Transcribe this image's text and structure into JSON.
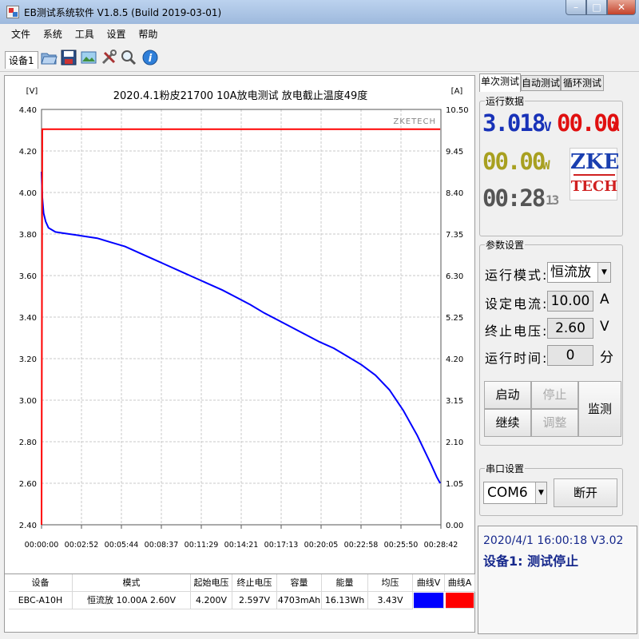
{
  "window": {
    "title": "EB测试系统软件 V1.8.5 (Build 2019-03-01)",
    "min": "–",
    "max": "□",
    "close": "✕"
  },
  "menu": [
    "文件",
    "系统",
    "工具",
    "设置",
    "帮助"
  ],
  "toolbar": {
    "device_tab": "设备1",
    "icons": [
      "open-folder-icon",
      "save-disk-icon",
      "picture-icon",
      "tools-icon",
      "search-icon",
      "info-icon"
    ]
  },
  "chart_data": {
    "type": "line",
    "title": "2020.4.1粉皮21700 10A放电测试 放电截止温度49度",
    "watermark": "ZKETECH",
    "left_unit": "[V]",
    "right_unit": "[A]",
    "y_left_ticks": [
      "4.40",
      "4.20",
      "4.00",
      "3.80",
      "3.60",
      "3.40",
      "3.20",
      "3.00",
      "2.80",
      "2.60",
      "2.40"
    ],
    "y_right_ticks": [
      "10.50",
      "9.45",
      "8.40",
      "7.35",
      "6.30",
      "5.25",
      "4.20",
      "3.15",
      "2.10",
      "1.05",
      "0.00"
    ],
    "x_ticks": [
      "00:00:00",
      "00:02:52",
      "00:05:44",
      "00:08:37",
      "00:11:29",
      "00:14:21",
      "00:17:13",
      "00:20:05",
      "00:22:58",
      "00:25:50",
      "00:28:42"
    ],
    "ylim_left": [
      2.4,
      4.4
    ],
    "ylim_right": [
      0.0,
      10.5
    ],
    "xlim_min": [
      0,
      28.7
    ],
    "grid": true,
    "series": [
      {
        "name": "曲线V",
        "axis": "left",
        "color": "#0000ff",
        "x": [
          0,
          0.05,
          0.15,
          0.3,
          0.5,
          1,
          1.5,
          2,
          2.5,
          3,
          4,
          5,
          6,
          7,
          8,
          9,
          10,
          11,
          12,
          13,
          14,
          15,
          16,
          17,
          18,
          19,
          20,
          21,
          22,
          23,
          24,
          25,
          26,
          26.5,
          27,
          27.5,
          28,
          28.4,
          28.65
        ],
        "y": [
          4.1,
          3.98,
          3.9,
          3.86,
          3.83,
          3.81,
          3.805,
          3.8,
          3.795,
          3.79,
          3.78,
          3.76,
          3.74,
          3.71,
          3.68,
          3.65,
          3.62,
          3.59,
          3.56,
          3.53,
          3.495,
          3.46,
          3.42,
          3.385,
          3.35,
          3.315,
          3.28,
          3.25,
          3.21,
          3.17,
          3.12,
          3.05,
          2.95,
          2.89,
          2.83,
          2.76,
          2.69,
          2.63,
          2.6
        ]
      },
      {
        "name": "曲线A",
        "axis": "right",
        "color": "#ff0000",
        "x": [
          0,
          0.05,
          28.65
        ],
        "y": [
          0,
          10.0,
          10.0
        ]
      }
    ]
  },
  "table": {
    "headers": [
      "设备",
      "模式",
      "起始电压",
      "终止电压",
      "容量",
      "能量",
      "均压",
      "曲线V",
      "曲线A"
    ],
    "row": [
      "EBC-A10H",
      "恒流放  10.00A  2.60V",
      "4.200V",
      "2.597V",
      "4703mAh",
      "16.13Wh",
      "3.43V"
    ],
    "curve_v_color": "#0000ff",
    "curve_a_color": "#ff0000"
  },
  "right": {
    "tabs": [
      "单次测试",
      "自动测试",
      "循环测试"
    ],
    "run_group": "运行数据",
    "voltage": "3.018",
    "voltage_unit": "V",
    "current": "00.00",
    "current_unit": "A",
    "power": "00.00",
    "power_unit": "W",
    "time_main": "00:28",
    "time_sec": "13",
    "logo_top": "ZKE",
    "logo_bottom": "TECH",
    "param_group": "参数设置",
    "mode_label": "运行模式:",
    "mode_value": "恒流放",
    "current_label": "设定电流:",
    "current_value": "10.00",
    "current_set_unit": "A",
    "cutoff_label": "终止电压:",
    "cutoff_value": "2.60",
    "cutoff_unit": "V",
    "runtime_label": "运行时间:",
    "runtime_value": "0",
    "runtime_unit": "分",
    "btn_start": "启动",
    "btn_stop": "停止",
    "btn_monitor": "监测",
    "btn_continue": "继续",
    "btn_adjust": "调整",
    "serial_group": "串口设置",
    "com_value": "COM6",
    "btn_disconnect": "断开",
    "status_line1": "2020/4/1 16:00:18  V3.02",
    "status_line2": "设备1: 测试停止"
  }
}
